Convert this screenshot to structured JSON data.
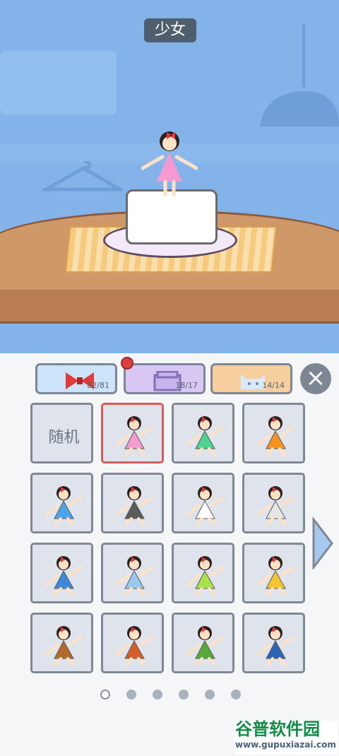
{
  "scene": {
    "title": "少女",
    "colors": {
      "wall": "#84b3ea",
      "table": "#cf9868"
    }
  },
  "tabs": [
    {
      "icon": "bow-icon",
      "count": "82/81"
    },
    {
      "icon": "box-icon",
      "count": "18/17"
    },
    {
      "icon": "cat-icon",
      "count": "14/14"
    }
  ],
  "random_label": "随机",
  "watermark": {
    "brand": "谷普软件园",
    "url": "www.gupuxiazai.com"
  }
}
